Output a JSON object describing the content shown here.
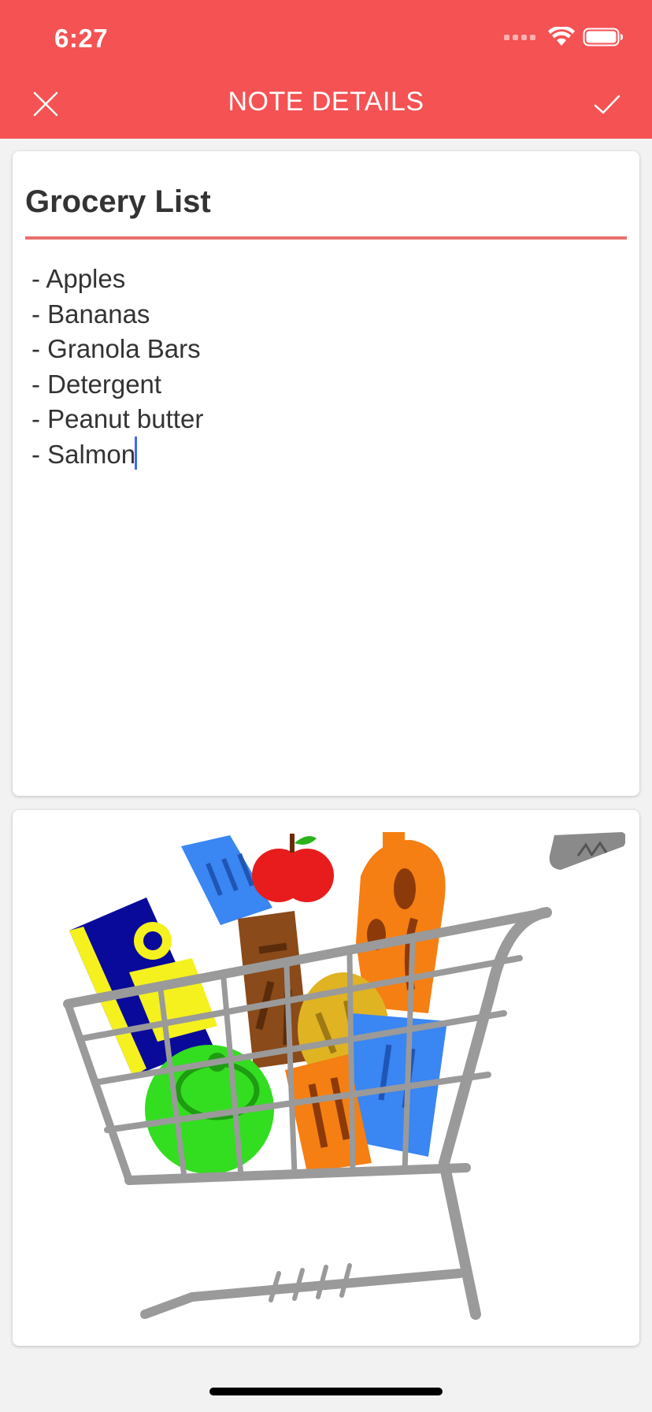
{
  "status_bar": {
    "time": "6:27"
  },
  "header": {
    "title": "NOTE DETAILS"
  },
  "note": {
    "title": "Grocery List",
    "body": "- Apples\n- Bananas\n- Granola Bars\n- Detergent\n- Peanut butter\n- Salmon"
  },
  "colors": {
    "accent": "#f55253",
    "divider": "#eb6f6f",
    "caret": "#3d6bf0",
    "background": "#f2f2f2"
  },
  "icons": {
    "close": "close-icon",
    "save": "check-icon",
    "signal": "cellular-signal-icon",
    "wifi": "wifi-icon",
    "battery": "battery-icon"
  }
}
